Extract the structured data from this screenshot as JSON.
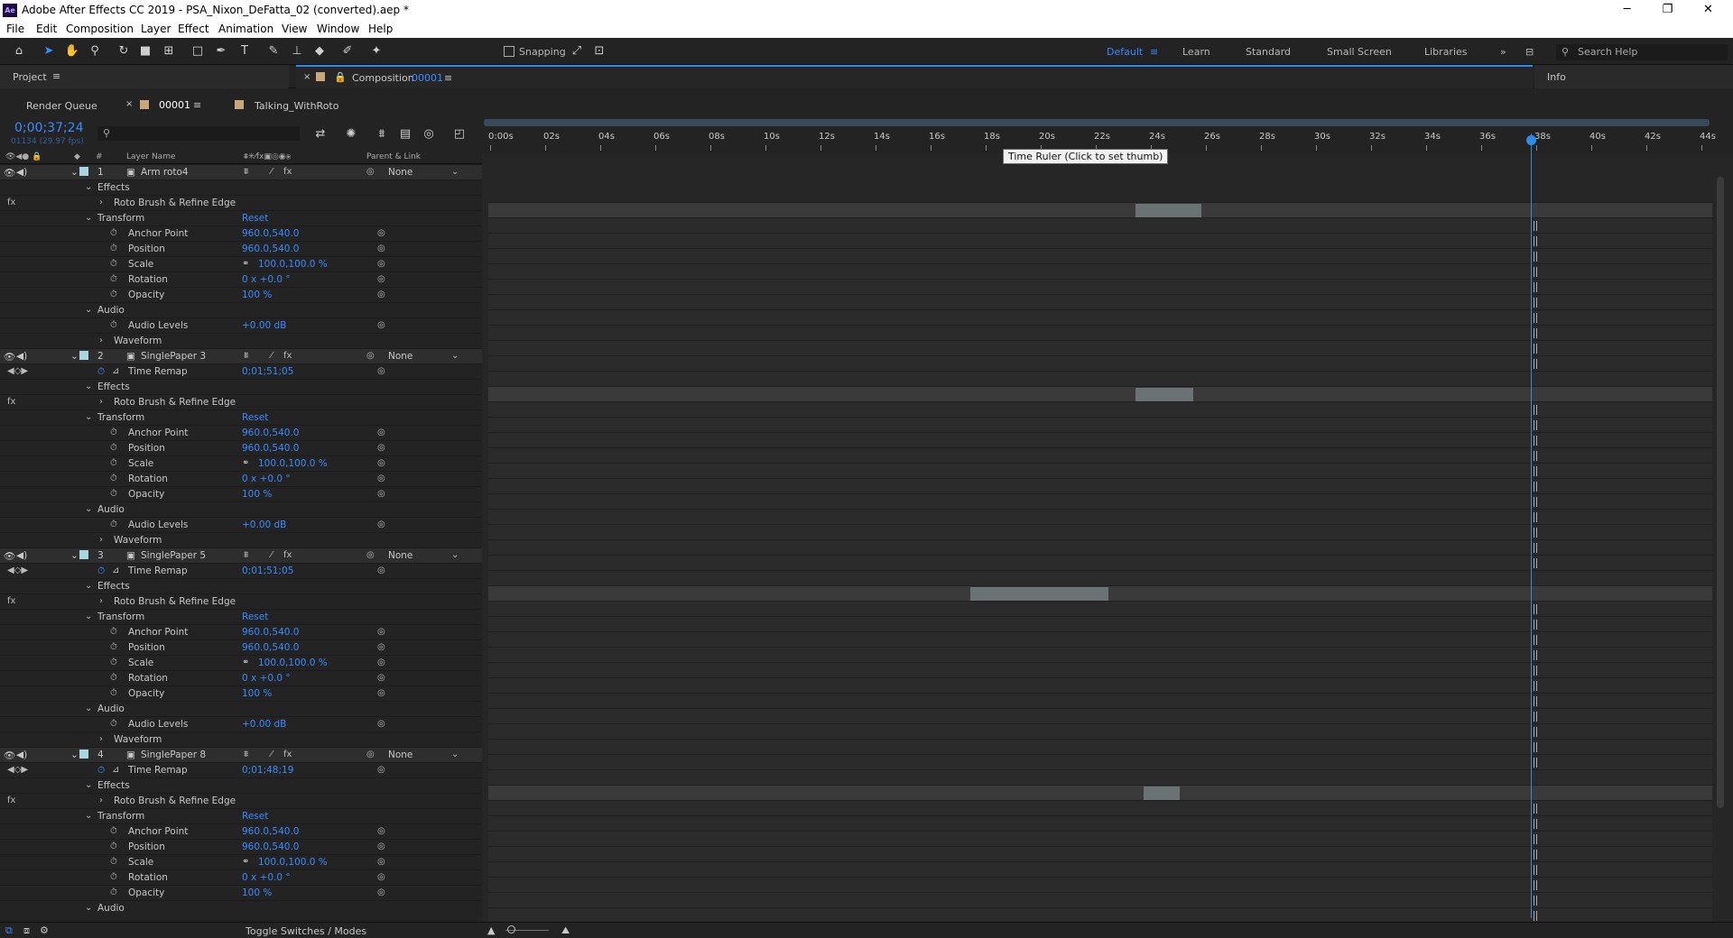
{
  "window": {
    "title": "Adobe After Effects CC 2019 - PSA_Nixon_DeFatta_02 (converted).aep *",
    "app_icon": "Ae",
    "controls": [
      "─",
      "❐",
      "✕"
    ]
  },
  "menu": [
    "File",
    "Edit",
    "Composition",
    "Layer",
    "Effect",
    "Animation",
    "View",
    "Window",
    "Help"
  ],
  "toolbar": {
    "snapping": "Snapping",
    "workspaces": [
      "Default",
      "Learn",
      "Standard",
      "Small Screen",
      "Libraries"
    ],
    "active_workspace": "Default",
    "search_placeholder": "Search Help"
  },
  "panels": {
    "project": "Project",
    "composition_prefix": "Composition",
    "composition_name": "00001",
    "info": "Info"
  },
  "timeline_tabs": {
    "render_queue": "Render Queue",
    "tab1": "00001",
    "tab2": "Talking_WithRoto"
  },
  "timecode": {
    "current": "0;00;37;24",
    "sub": "01134 (29.97 fps)"
  },
  "columns": {
    "layer_name": "Layer Name",
    "parent": "Parent & Link"
  },
  "ruler": {
    "ticks": [
      "0:00s",
      "02s",
      "04s",
      "06s",
      "08s",
      "10s",
      "12s",
      "14s",
      "16s",
      "18s",
      "20s",
      "22s",
      "24s",
      "26s",
      "28s",
      "30s",
      "32s",
      "34s",
      "36s",
      "38s",
      "40s",
      "42s",
      "44s"
    ],
    "tooltip": "Time Ruler (Click to set thumb)",
    "playhead_seconds": 37.8,
    "duration_seconds": 44.8
  },
  "labels": {
    "effects": "Effects",
    "roto": "Roto Brush & Refine Edge",
    "transform": "Transform",
    "reset": "Reset",
    "anchor": "Anchor Point",
    "position": "Position",
    "scale": "Scale",
    "rotation": "Rotation",
    "opacity": "Opacity",
    "audio": "Audio",
    "audio_levels": "Audio Levels",
    "waveform": "Waveform",
    "time_remap": "Time Remap",
    "none": "None"
  },
  "layers": [
    {
      "num": "1",
      "name": "Arm roto4",
      "color": "#a9d6e0",
      "time_remap": null,
      "anchor": "960.0,540.0",
      "position": "960.0,540.0",
      "scale": "100.0,100.0 %",
      "rotation": "0 x +0.0 °",
      "opacity": "100 %",
      "audio_levels": "+0.00 dB",
      "bar_start": 23.2,
      "bar_end": 25.6
    },
    {
      "num": "2",
      "name": "SinglePaper 3",
      "color": "#a9d6e0",
      "time_remap": "0;01;51;05",
      "anchor": "960.0,540.0",
      "position": "960.0,540.0",
      "scale": "100.0,100.0 %",
      "rotation": "0 x +0.0 °",
      "opacity": "100 %",
      "audio_levels": "+0.00 dB",
      "bar_start": 23.2,
      "bar_end": 25.3
    },
    {
      "num": "3",
      "name": "SinglePaper 5",
      "color": "#a9d6e0",
      "time_remap": "0;01;51;05",
      "anchor": "960.0,540.0",
      "position": "960.0,540.0",
      "scale": "100.0,100.0 %",
      "rotation": "0 x +0.0 °",
      "opacity": "100 %",
      "audio_levels": "+0.00 dB",
      "bar_start": 17.2,
      "bar_end": 22.2
    },
    {
      "num": "4",
      "name": "SinglePaper 8",
      "color": "#a9d6e0",
      "time_remap": "0;01;48;19",
      "anchor": "960.0,540.0",
      "position": "960.0,540.0",
      "scale": "100.0,100.0 %",
      "rotation": "0 x +0.0 °",
      "opacity": "100 %",
      "audio_levels": null,
      "bar_start": 23.5,
      "bar_end": 24.8
    }
  ],
  "status": {
    "toggle": "Toggle Switches / Modes"
  }
}
